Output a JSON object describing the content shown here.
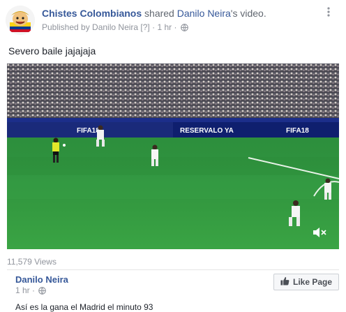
{
  "post": {
    "page_name": "Chistes Colombianos",
    "shared_text": " shared ",
    "owner_name": "Danilo Neira",
    "owner_suffix": "'s video.",
    "published_prefix": "Published by ",
    "published_by": "Danilo Neira",
    "help_marker": " [?]",
    "separator": " · ",
    "time": "1 hr",
    "caption": "Severo baile jajajaja"
  },
  "video": {
    "banner_left": "FIFA18",
    "banner_center": "RESERVALO YA",
    "banner_right": "FIFA18"
  },
  "views": "11,579 Views",
  "original": {
    "name": "Danilo Neira",
    "time": "1 hr",
    "separator": " · ",
    "like_page_label": "Like Page",
    "text": "Así es la gana el Madrid el minuto 93"
  },
  "icons": {
    "globe": "globe-icon",
    "more": "more-options-icon",
    "mute": "muted-speaker-icon",
    "thumb": "thumbs-up-icon"
  },
  "colors": {
    "link": "#365899",
    "meta": "#90949c",
    "pitch": "#2f8a3a"
  }
}
